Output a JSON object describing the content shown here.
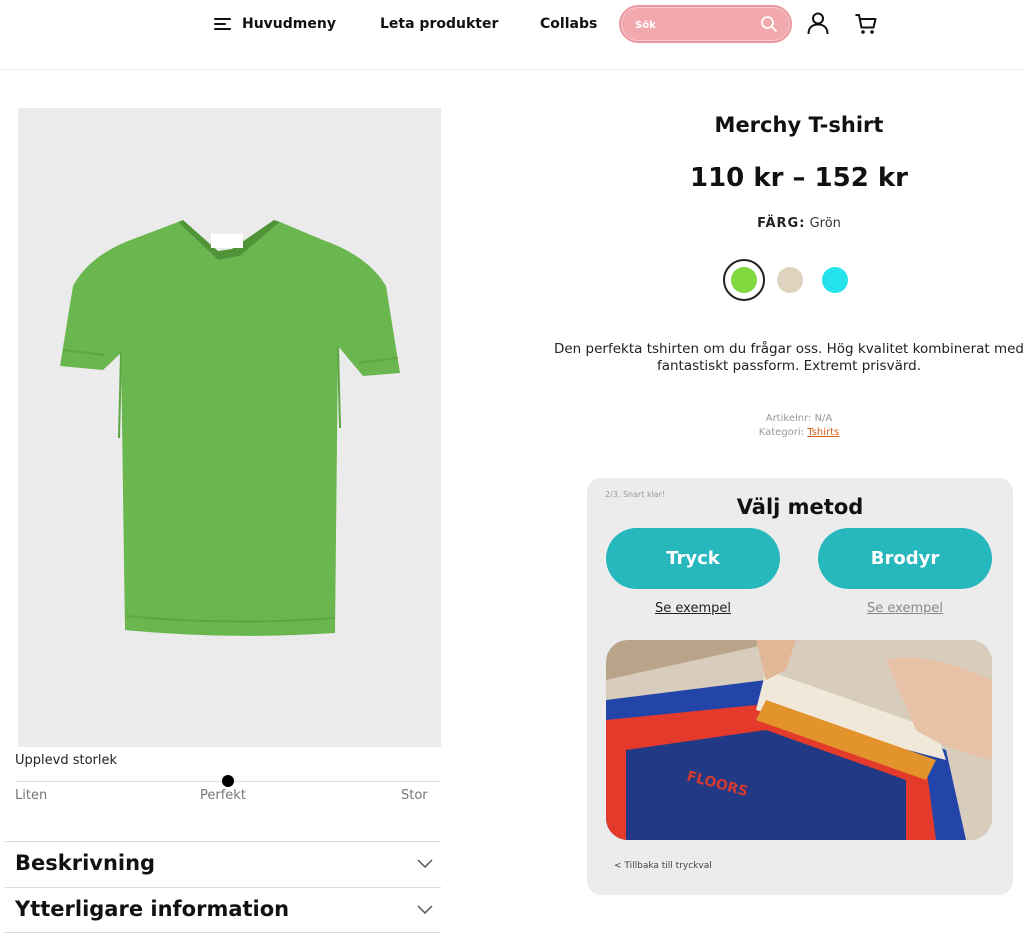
{
  "header": {
    "menu_label": "Huvudmeny",
    "products_label": "Leta produkter",
    "collabs_label": "Collabs",
    "search_placeholder": "Sök"
  },
  "product": {
    "title": "Merchy T-shirt",
    "price": "110 kr – 152 kr",
    "color_label": "FÄRG:",
    "color_value": "Grön",
    "swatches": [
      {
        "name": "green",
        "color": "#7fd83e",
        "selected": true
      },
      {
        "name": "beige",
        "color": "#ddd3bf",
        "selected": false
      },
      {
        "name": "cyan",
        "color": "#25e3ec",
        "selected": false
      }
    ],
    "description_line1": "Den perfekta tshirten om du frågar oss. Hög kvalitet kombinerat med",
    "description_line2": "fantastiskt passform. Extremt prisvärd.",
    "article_label": "Artikelnr: N/A",
    "category_label": "Kategori:",
    "category_value": "Tshirts",
    "shirt_color": "#6bb74f"
  },
  "size": {
    "title": "Upplevd storlek",
    "small": "Liten",
    "perfect": "Perfekt",
    "large": "Stor"
  },
  "accordions": {
    "description": "Beskrivning",
    "info": "Ytterligare information"
  },
  "method": {
    "step": "2/3. Snart klar!",
    "title": "Välj metod",
    "print_label": "Tryck",
    "embroidery_label": "Brodyr",
    "example_label": "Se exempel",
    "back_label": "< Tillbaka till tryckval",
    "accent_color": "#27b8bd"
  }
}
